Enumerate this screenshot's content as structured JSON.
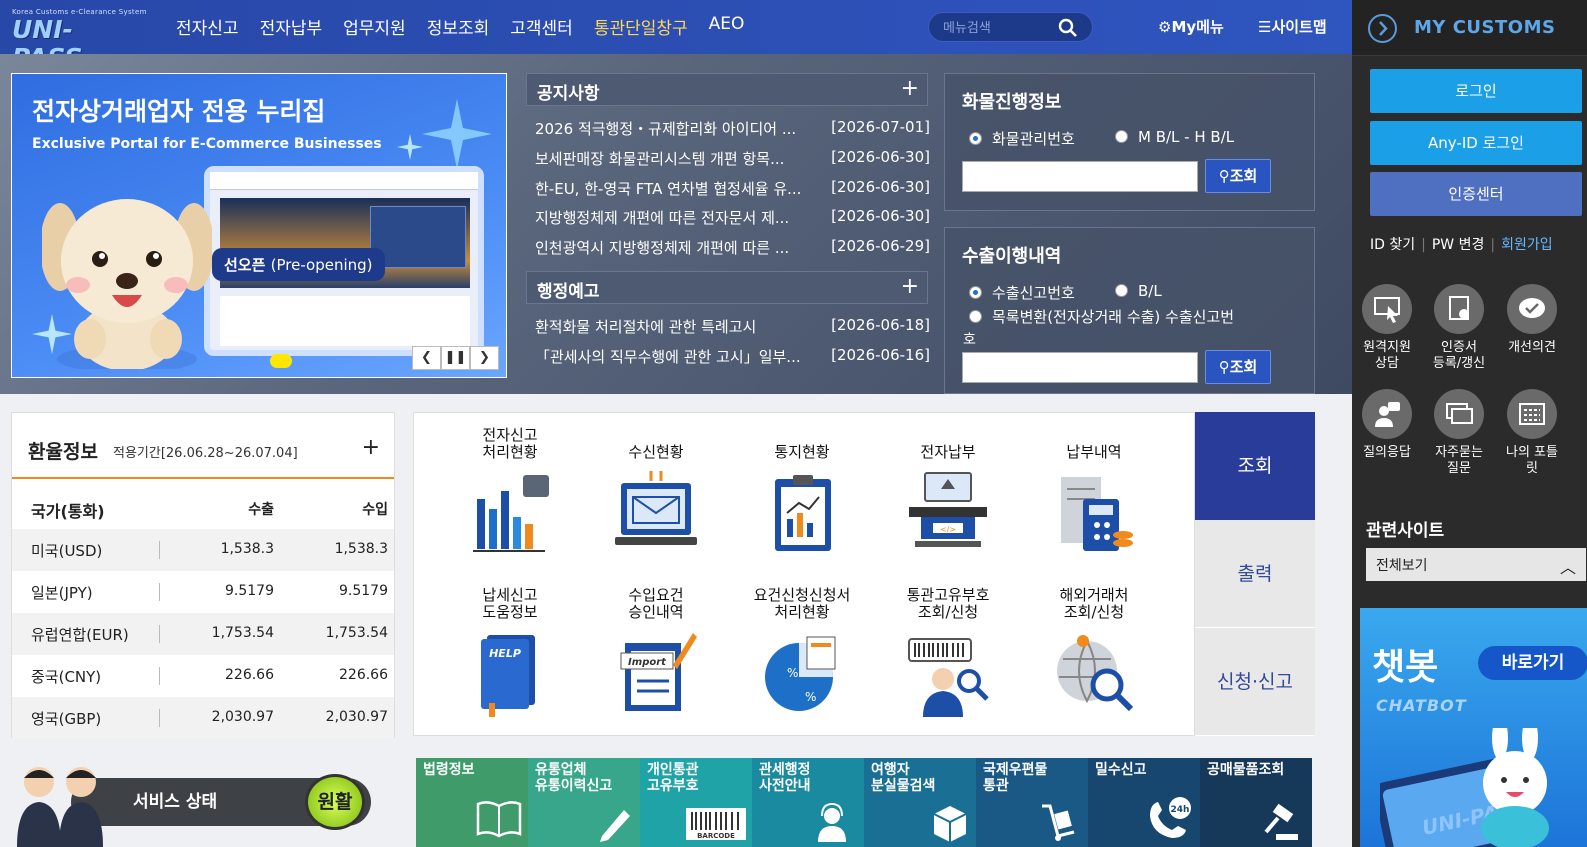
{
  "header": {
    "logo_tagline": "Korea Customs e-Clearance System",
    "logo_word": "UNI-PASS",
    "nav": [
      "전자신고",
      "전자납부",
      "업무지원",
      "정보조회",
      "고객센터",
      "통관단일창구",
      "AEO"
    ],
    "search_placeholder": "메뉴검색",
    "mymenu_label": "My메뉴",
    "sitemap_label": "사이트맵"
  },
  "banner": {
    "headline": "전자상거래업자 전용 누리집",
    "subheadline": "Exclusive Portal for E-Commerce Businesses",
    "badge_main": "선오픈",
    "badge_sub": "(Pre-opening)"
  },
  "notices": {
    "title": "공지사항",
    "items": [
      {
        "title": "2026 적극행정・규제합리화 아이디어 ...",
        "date": "[2026-07-01]"
      },
      {
        "title": "보세판매장 화물관리시스템 개편 항목...",
        "date": "[2026-06-30]"
      },
      {
        "title": "한-EU, 한-영국 FTA 연차별 협정세율 유...",
        "date": "[2026-06-30]"
      },
      {
        "title": "지방행정체제 개편에 따른 전자문서 제...",
        "date": "[2026-06-30]"
      },
      {
        "title": "인천광역시 지방행정체제 개편에 따른 ...",
        "date": "[2026-06-29]"
      }
    ]
  },
  "admin": {
    "title": "행정예고",
    "items": [
      {
        "title": "환적화물 처리절차에 관한 특례고시",
        "date": "[2026-06-18]"
      },
      {
        "title": "「관세사의 직무수행에 관한 고시」일부...",
        "date": "[2026-06-16]"
      }
    ]
  },
  "cargo": {
    "title": "화물진행정보",
    "radio1": "화물관리번호",
    "radio2": "M B/L - H B/L",
    "button": "조회"
  },
  "export": {
    "title": "수출이행내역",
    "radio1": "수출신고번호",
    "radio2": "B/L",
    "radio3": "목록변환(전자상거래 수출) 수출신고번",
    "radio3_wrap": "호",
    "button": "조회"
  },
  "fx": {
    "title": "환율정보",
    "period": "적용기간[26.06.28~26.07.04]",
    "columns": [
      "국가(통화)",
      "수출",
      "수입"
    ],
    "rows": [
      [
        "미국(USD)",
        "1,538.3",
        "1,538.3"
      ],
      [
        "일본(JPY)",
        "9.5179",
        "9.5179"
      ],
      [
        "유럽연합(EUR)",
        "1,753.54",
        "1,753.54"
      ],
      [
        "중국(CNY)",
        "226.66",
        "226.66"
      ],
      [
        "영국(GBP)",
        "2,030.97",
        "2,030.97"
      ]
    ]
  },
  "service_status": {
    "label": "서비스 상태",
    "state": "원활"
  },
  "services": [
    {
      "line1": "전자신고",
      "line2": "처리현황"
    },
    {
      "line1": "수신현황",
      "line2": ""
    },
    {
      "line1": "통지현황",
      "line2": ""
    },
    {
      "line1": "전자납부",
      "line2": ""
    },
    {
      "line1": "납부내역",
      "line2": ""
    },
    {
      "line1": "납세신고",
      "line2": "도움정보"
    },
    {
      "line1": "수입요건",
      "line2": "승인내역"
    },
    {
      "line1": "요건신청신청서",
      "line2": "처리현황"
    },
    {
      "line1": "통관고유부호",
      "line2": "조회/신청"
    },
    {
      "line1": "해외거래처",
      "line2": "조회/신청"
    }
  ],
  "service_icons": {
    "help_text": "HELP",
    "import_text": "Import",
    "percent_text": "%"
  },
  "tabs": [
    "조회",
    "출력",
    "신청·신고"
  ],
  "tiles": [
    {
      "line1": "법령정보",
      "line2": "",
      "color": "#3f9b6a"
    },
    {
      "line1": "유통업체",
      "line2": "유통이력신고",
      "color": "#37a68a"
    },
    {
      "line1": "개인통관",
      "line2": "고유부호",
      "color": "#1fa3a6"
    },
    {
      "line1": "관세행정",
      "line2": "사전안내",
      "color": "#1a8aa0"
    },
    {
      "line1": "여행자",
      "line2": "분실물검색",
      "color": "#1a6f95"
    },
    {
      "line1": "국제우편물",
      "line2": "통관",
      "color": "#1a5985"
    },
    {
      "line1": "밀수신고",
      "line2": "",
      "color": "#17476e"
    },
    {
      "line1": "공매물품조회",
      "line2": "",
      "color": "#16395a"
    }
  ],
  "tile_icons": {
    "barcode_text": "BARCODE",
    "hours_text": "24h"
  },
  "sidebar": {
    "title": "MY CUSTOMS",
    "login": "로그인",
    "anyid": "Any-ID 로그인",
    "cert": "인증센터",
    "find_id": "ID 찾기",
    "change_pw": "PW 변경",
    "join": "회원가입",
    "quick": [
      {
        "line1": "원격지원",
        "line2": "상담"
      },
      {
        "line1": "인증서",
        "line2": "등록/갱신"
      },
      {
        "line1": "개선의견",
        "line2": ""
      },
      {
        "line1": "질의응답",
        "line2": ""
      },
      {
        "line1": "자주묻는",
        "line2": "질문"
      },
      {
        "line1": "나의 포틀",
        "line2": "릿"
      }
    ],
    "related_title": "관련사이트",
    "related_select": "전체보기",
    "chatbot_title": "챗봇",
    "chatbot_sub": "CHATBOT",
    "chatbot_go": "바로가기",
    "chatbot_phone_text": "UNI-PASS"
  }
}
